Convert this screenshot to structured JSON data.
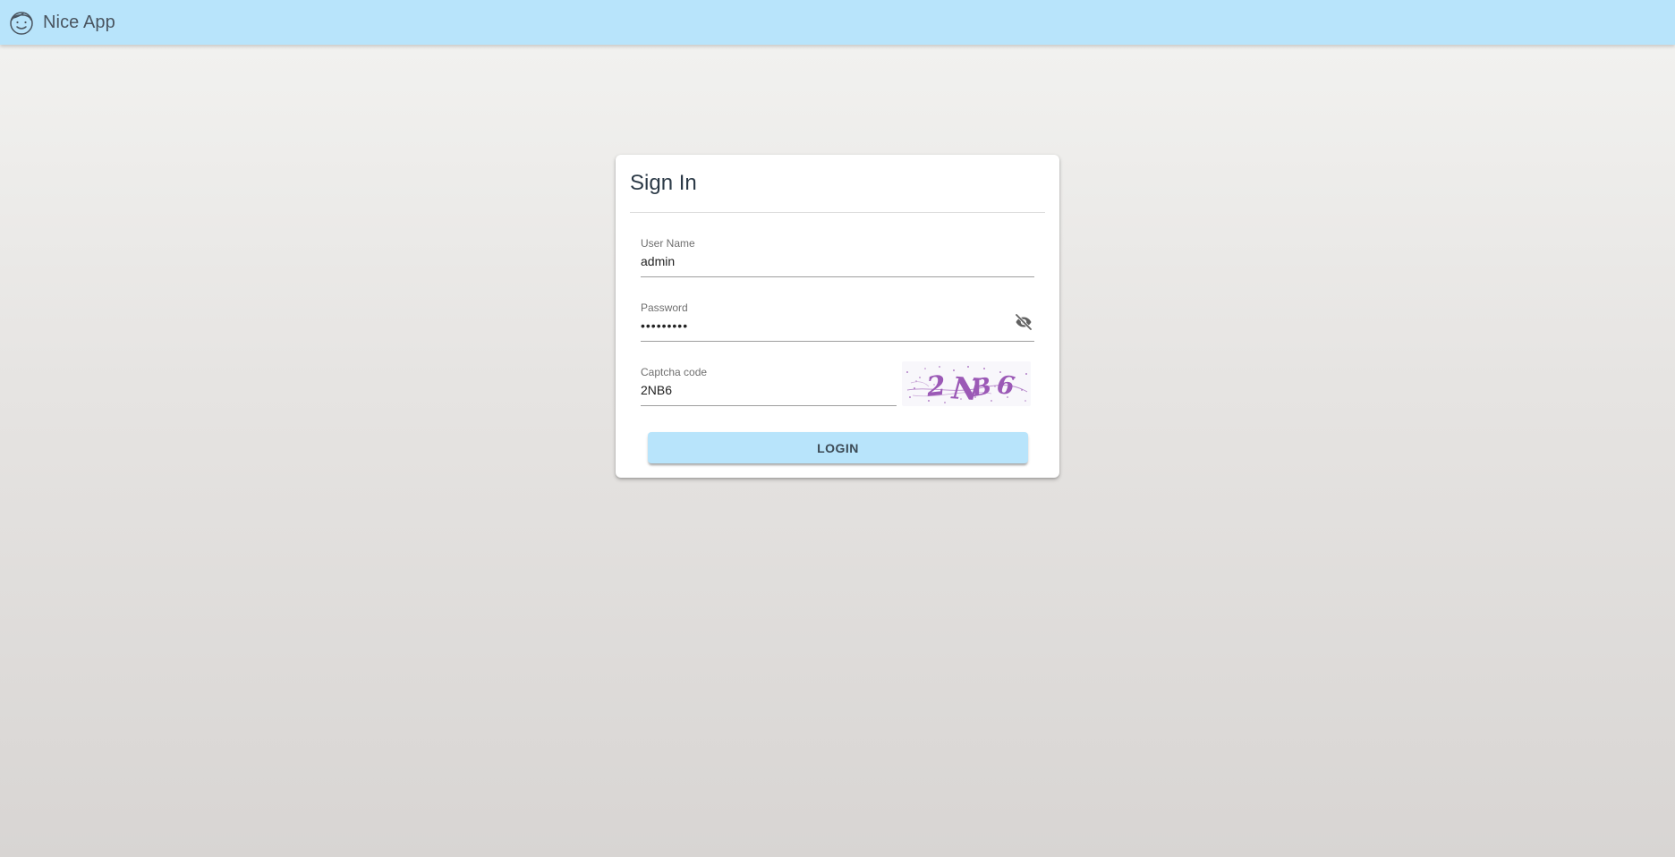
{
  "app": {
    "title": "Nice App",
    "logo_icon": "smiling-face-icon"
  },
  "colors": {
    "topbar": "#b8e4fb",
    "button": "#b8e4fb",
    "captcha_ink": "#9b59b6"
  },
  "login_form": {
    "title": "Sign In",
    "username": {
      "label": "User Name",
      "value": "admin"
    },
    "password": {
      "label": "Password",
      "value": "•••••••••",
      "toggle_icon": "eye-off-icon"
    },
    "captcha": {
      "label": "Captcha code",
      "value": "2NB6",
      "image_text": "2NB6"
    },
    "submit_label": "LOGIN"
  }
}
